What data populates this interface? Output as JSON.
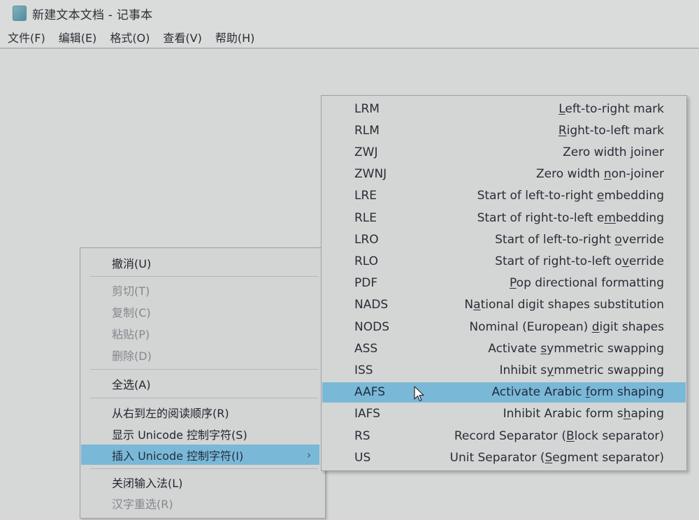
{
  "window": {
    "title": "新建文本文档 - 记事本",
    "icon": "notepad-icon"
  },
  "menubar": {
    "items": [
      {
        "label": "文件(F)"
      },
      {
        "label": "编辑(E)"
      },
      {
        "label": "格式(O)"
      },
      {
        "label": "查看(V)"
      },
      {
        "label": "帮助(H)"
      }
    ]
  },
  "context_menu": {
    "items": [
      {
        "label": "撤消(U)",
        "enabled": true
      },
      {
        "label": "剪切(T)",
        "enabled": false
      },
      {
        "label": "复制(C)",
        "enabled": false
      },
      {
        "label": "粘贴(P)",
        "enabled": false
      },
      {
        "label": "删除(D)",
        "enabled": false
      },
      {
        "label": "全选(A)",
        "enabled": true
      },
      {
        "label": "从右到左的阅读顺序(R)",
        "enabled": true
      },
      {
        "label": "显示 Unicode 控制字符(S)",
        "enabled": true
      },
      {
        "label": "插入 Unicode 控制字符(I)",
        "enabled": true,
        "highlighted": true,
        "submenu_arrow": "›"
      },
      {
        "label": "关闭输入法(L)",
        "enabled": true
      },
      {
        "label": "汉字重选(R)",
        "enabled": false
      }
    ]
  },
  "submenu": {
    "items": [
      {
        "code": "LRM",
        "pre": "",
        "key": "L",
        "post": "eft-to-right mark"
      },
      {
        "code": "RLM",
        "pre": "",
        "key": "R",
        "post": "ight-to-left mark"
      },
      {
        "code": "ZWJ",
        "pre": "Zero width ",
        "key": "j",
        "post": "oiner"
      },
      {
        "code": "ZWNJ",
        "pre": "Zero width ",
        "key": "n",
        "post": "on-joiner"
      },
      {
        "code": "LRE",
        "pre": "Start of left-to-right ",
        "key": "e",
        "post": "mbedding"
      },
      {
        "code": "RLE",
        "pre": "Start of right-to-left e",
        "key": "m",
        "post": "bedding"
      },
      {
        "code": "LRO",
        "pre": "Start of left-to-right ",
        "key": "o",
        "post": "verride"
      },
      {
        "code": "RLO",
        "pre": "Start of right-to-left o",
        "key": "v",
        "post": "erride"
      },
      {
        "code": "PDF",
        "pre": "",
        "key": "P",
        "post": "op directional formatting"
      },
      {
        "code": "NADS",
        "pre": "N",
        "key": "a",
        "post": "tional digit shapes substitution"
      },
      {
        "code": "NODS",
        "pre": "Nominal (European) ",
        "key": "d",
        "post": "igit shapes"
      },
      {
        "code": "ASS",
        "pre": "Activate ",
        "key": "s",
        "post": "ymmetric swapping"
      },
      {
        "code": "ISS",
        "pre": "Inhibit s",
        "key": "y",
        "post": "mmetric swapping"
      },
      {
        "code": "AAFS",
        "pre": "Activate Arabic ",
        "key": "f",
        "post": "orm shaping",
        "highlighted": true
      },
      {
        "code": "IAFS",
        "pre": "Inhibit Arabic form s",
        "key": "h",
        "post": "aping"
      },
      {
        "code": "RS",
        "pre": "Record Separator (",
        "key": "B",
        "post": "lock separator)"
      },
      {
        "code": "US",
        "pre": "Unit Separator (",
        "key": "S",
        "post": "egment separator)"
      }
    ]
  },
  "colors": {
    "highlight": "#7ab8d8",
    "background": "#d6d9d8",
    "text": "#2a2a33",
    "disabled_text": "#85878c"
  }
}
